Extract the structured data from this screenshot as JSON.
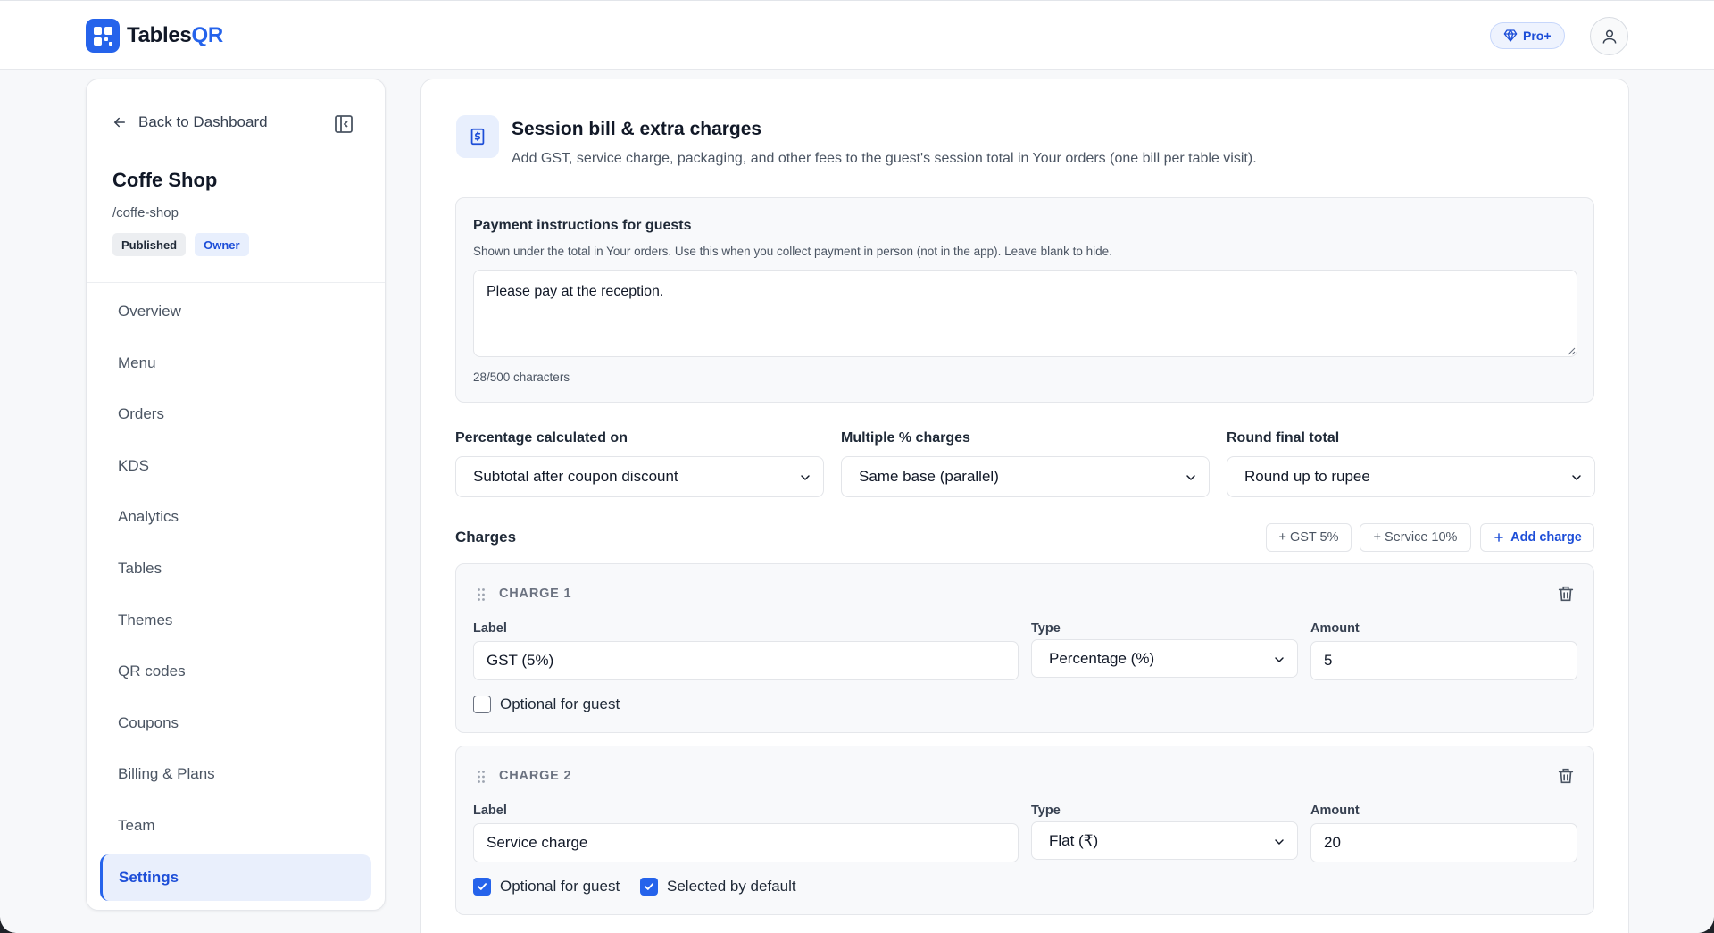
{
  "app": {
    "name_main": "Tables",
    "name_accent": "QR",
    "plan_badge": "Pro+",
    "accent_color": "#2563eb"
  },
  "sidebar": {
    "back_label": "Back to Dashboard",
    "shop_name": "Coffe Shop",
    "shop_slug": "/coffe-shop",
    "badges": [
      "Published",
      "Owner"
    ],
    "items": [
      {
        "label": "Overview"
      },
      {
        "label": "Menu"
      },
      {
        "label": "Orders"
      },
      {
        "label": "KDS"
      },
      {
        "label": "Analytics"
      },
      {
        "label": "Tables"
      },
      {
        "label": "Themes"
      },
      {
        "label": "QR codes"
      },
      {
        "label": "Coupons"
      },
      {
        "label": "Billing & Plans"
      },
      {
        "label": "Team"
      },
      {
        "label": "Settings",
        "active": true
      }
    ]
  },
  "section": {
    "title": "Session bill & extra charges",
    "description": "Add GST, service charge, packaging, and other fees to the guest's session total in Your orders (one bill per table visit).",
    "icon": "receipt-icon"
  },
  "payment": {
    "title": "Payment instructions for guests",
    "help": "Shown under the total in Your orders. Use this when you collect payment in person (not in the app). Leave blank to hide.",
    "value": "Please pay at the reception.",
    "char_count": "28/500 characters"
  },
  "settings": {
    "percentage_label": "Percentage calculated on",
    "percentage_value": "Subtotal after coupon discount",
    "multiple_label": "Multiple % charges",
    "multiple_value": "Same base (parallel)",
    "round_label": "Round final total",
    "round_value": "Round up to rupee"
  },
  "charges": {
    "title": "Charges",
    "quick_gst": "+ GST 5%",
    "quick_service": "+ Service 10%",
    "add_label": "Add charge",
    "field_labels": {
      "label": "Label",
      "type": "Type",
      "amount": "Amount"
    },
    "optional_label": "Optional for guest",
    "default_label": "Selected by default",
    "items": [
      {
        "heading": "CHARGE 1",
        "label": "GST (5%)",
        "type": "Percentage (%)",
        "amount": "5",
        "optional": false
      },
      {
        "heading": "CHARGE 2",
        "label": "Service charge",
        "type": "Flat (₹)",
        "amount": "20",
        "optional": true,
        "selected_default": true
      }
    ]
  }
}
